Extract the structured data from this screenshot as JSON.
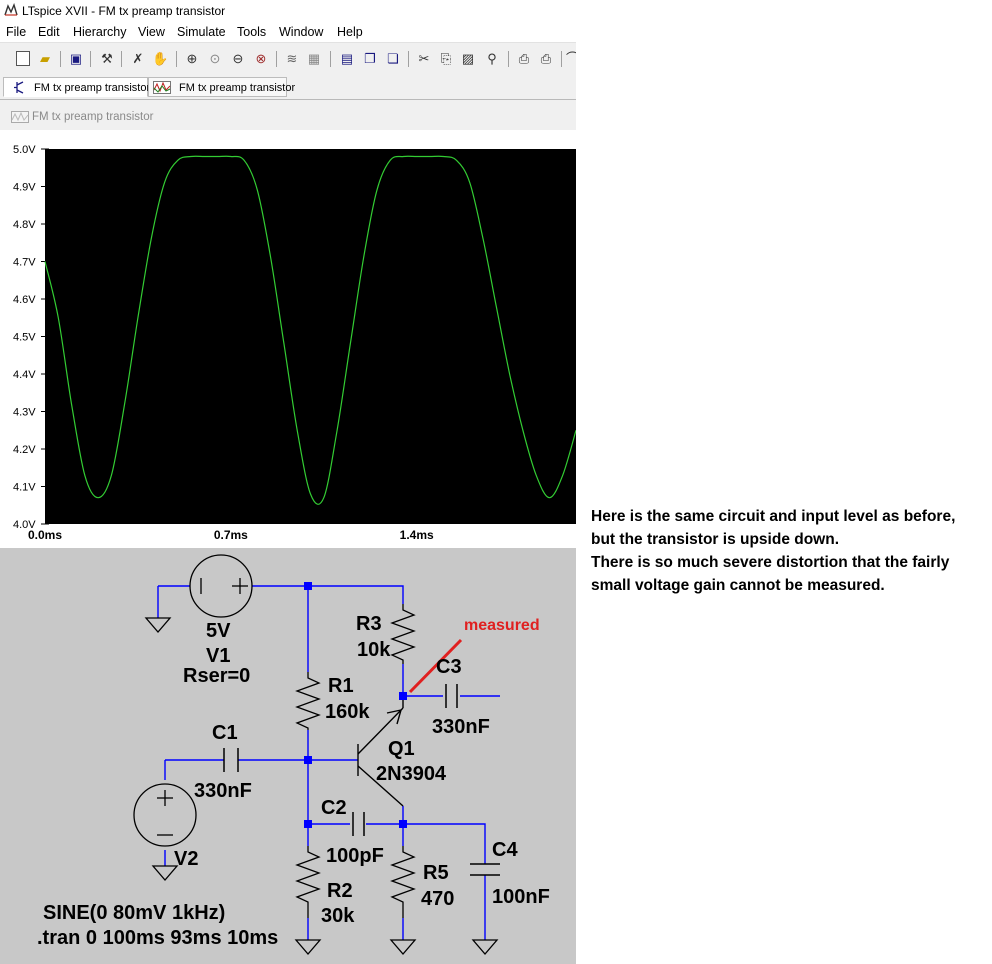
{
  "window": {
    "title": "LTspice XVII - FM tx preamp transistor"
  },
  "menu": [
    "File",
    "Edit",
    "Hierarchy",
    "View",
    "Simulate",
    "Tools",
    "Window",
    "Help"
  ],
  "tabs": [
    {
      "label": "FM tx preamp transistor",
      "icon": "schematic-tab-icon"
    },
    {
      "label": "FM tx preamp transistor",
      "icon": "waveform-tab-icon"
    }
  ],
  "pane_title": "FM tx preamp transistor",
  "chart_data": {
    "type": "line",
    "y_ticks": [
      "5.0V",
      "4.9V",
      "4.8V",
      "4.7V",
      "4.6V",
      "4.5V",
      "4.4V",
      "4.3V",
      "4.2V",
      "4.1V",
      "4.0V"
    ],
    "x_ticks": [
      "0.0ms",
      "0.7ms",
      "1.4ms"
    ],
    "ylim": [
      4.0,
      5.0
    ],
    "xlim": [
      0.0,
      2.0
    ],
    "grid": false,
    "background": "#000000",
    "series": [
      {
        "color": "#33cc33",
        "x": [
          0.0,
          0.05,
          0.1,
          0.15,
          0.2,
          0.25,
          0.3,
          0.35,
          0.4,
          0.45,
          0.5,
          0.55,
          0.6,
          0.65,
          0.7,
          0.75,
          0.8,
          0.85,
          0.9,
          0.95,
          1.0,
          1.05,
          1.1,
          1.15,
          1.2,
          1.25,
          1.3,
          1.35,
          1.4,
          1.45,
          1.5,
          1.55,
          1.6,
          1.65,
          1.7,
          1.75,
          1.8,
          1.85,
          1.9,
          1.95,
          2.0
        ],
        "y": [
          4.7,
          4.55,
          4.32,
          4.13,
          4.07,
          4.13,
          4.32,
          4.55,
          4.76,
          4.91,
          4.97,
          4.98,
          4.98,
          4.98,
          4.98,
          4.97,
          4.89,
          4.71,
          4.48,
          4.25,
          4.08,
          4.07,
          4.25,
          4.48,
          4.71,
          4.89,
          4.97,
          4.98,
          4.98,
          4.98,
          4.98,
          4.97,
          4.91,
          4.76,
          4.58,
          4.4,
          4.25,
          4.13,
          4.07,
          4.13,
          4.25
        ]
      }
    ]
  },
  "schematic": {
    "v1": {
      "voltage": "5V",
      "name": "V1",
      "rser": "Rser=0"
    },
    "r3": {
      "name": "R3",
      "value": "10k"
    },
    "r1": {
      "name": "R1",
      "value": "160k"
    },
    "c1": {
      "name": "C1",
      "value": "330nF"
    },
    "c3": {
      "name": "C3",
      "value": "330nF"
    },
    "q1": {
      "name": "Q1",
      "model": "2N3904"
    },
    "c2": {
      "name": "C2",
      "value": "100pF"
    },
    "r2": {
      "name": "R2",
      "value": "30k"
    },
    "r5": {
      "name": "R5",
      "value": "470"
    },
    "c4": {
      "name": "C4",
      "value": "100nF"
    },
    "v2": {
      "name": "V2",
      "source": "SINE(0 80mV 1kHz)"
    },
    "directive": ".tran 0 100ms 93ms 10ms",
    "annotation": "measured",
    "annotation_color": "#e02020",
    "wire_color": "#0000ff",
    "junction_color": "#0000ff"
  },
  "note": {
    "lines": [
      "Here is the same circuit and input level as before,",
      "but the transistor is upside down.",
      "There is so much severe distortion that the fairly",
      "small voltage gain cannot be measured."
    ]
  }
}
